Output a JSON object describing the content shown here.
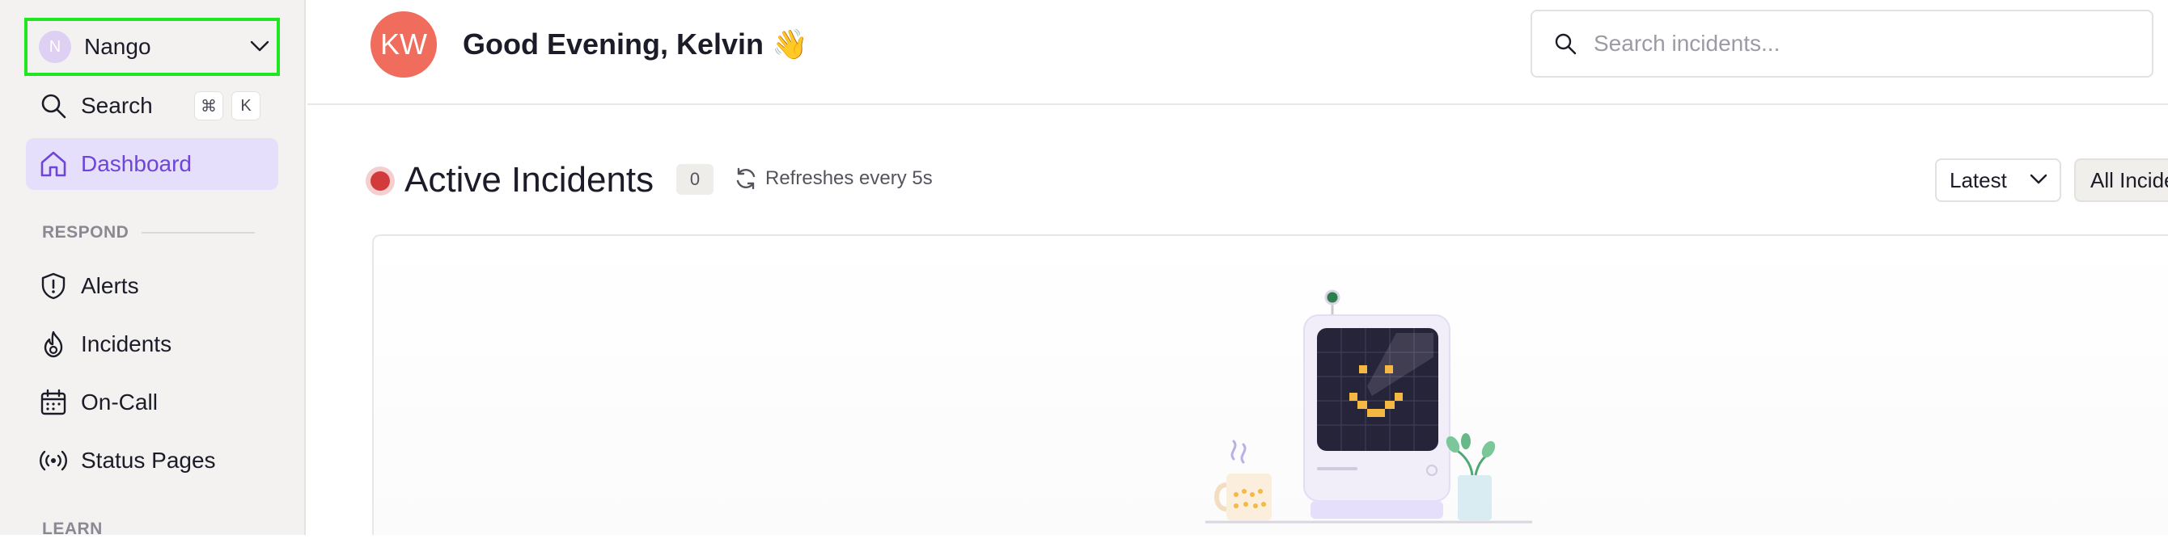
{
  "sidebar": {
    "org": {
      "initial": "N",
      "name": "Nango"
    },
    "search": {
      "label": "Search",
      "shortcut": [
        "⌘",
        "K"
      ]
    },
    "dashboard": {
      "label": "Dashboard"
    },
    "sections": [
      {
        "title": "RESPOND",
        "items": [
          "Alerts",
          "Incidents",
          "On-Call",
          "Status Pages"
        ]
      },
      {
        "title": "LEARN"
      }
    ]
  },
  "header": {
    "avatar_initials": "KW",
    "greeting": "Good Evening, Kelvin 👋",
    "search_placeholder": "Search incidents..."
  },
  "main": {
    "title": "Active Incidents",
    "count": "0",
    "refresh_text": "Refreshes every 5s",
    "sort": "Latest",
    "filter": "All Incidents"
  },
  "colors": {
    "accent": "#6f44d8",
    "active_bg": "#e6dffc",
    "status_red": "#d13b3b",
    "avatar": "#f06c5d",
    "focus_outline": "#22e522"
  }
}
